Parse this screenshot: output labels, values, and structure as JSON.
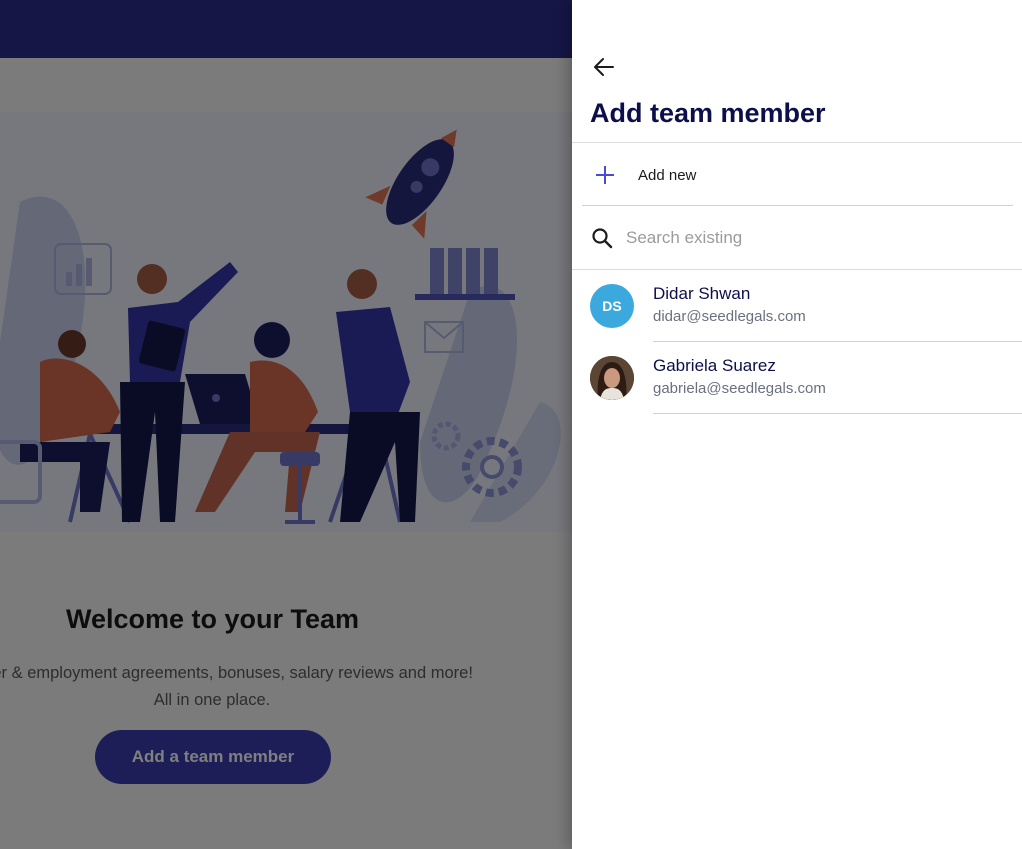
{
  "colors": {
    "topbar": "#2b2d8a",
    "primary_button": "#3a3cae",
    "accent_plus": "#4a4ad6",
    "initials_avatar": "#3ba9de",
    "title_navy": "#0d0f4a"
  },
  "background": {
    "title": "Welcome to your Team",
    "subtitle_line1": "founder & employment agreements, bonuses, salary reviews and more!",
    "subtitle_line2": "All in one place.",
    "cta_label": "Add a team member"
  },
  "drawer": {
    "back_icon": "arrow-left-icon",
    "title": "Add team member",
    "add_new_label": "Add new",
    "search": {
      "placeholder": "Search existing",
      "value": ""
    },
    "members": [
      {
        "initials": "DS",
        "name": "Didar Shwan",
        "email": "didar@seedlegals.com"
      },
      {
        "initials": "",
        "name": "Gabriela Suarez",
        "email": "gabriela@seedlegals.com"
      }
    ]
  }
}
